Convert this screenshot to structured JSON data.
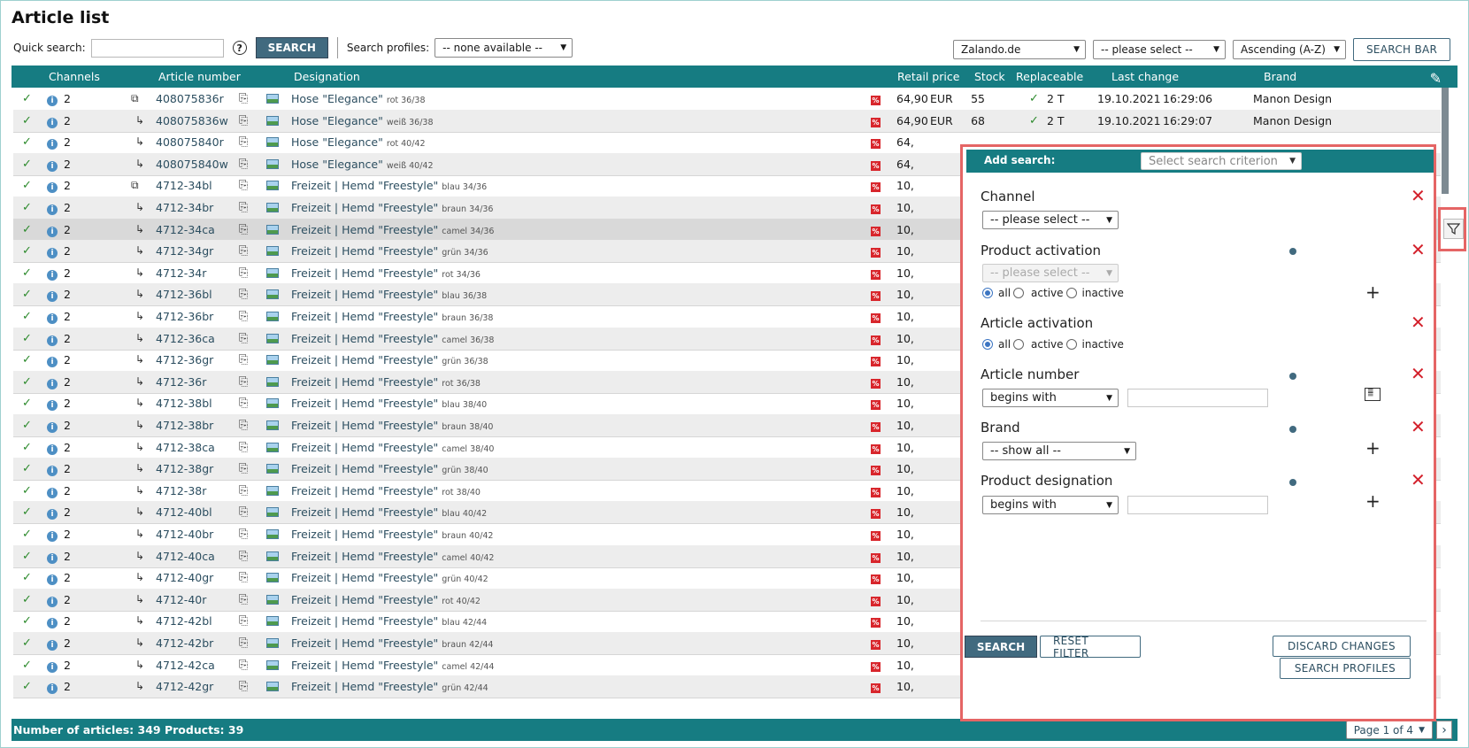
{
  "page": {
    "title": "Article list"
  },
  "toolbar": {
    "quick_search_label": "Quick search:",
    "quick_search_value": "",
    "help_icon": "?",
    "search_label": "SEARCH",
    "profiles_label": "Search profiles:",
    "profiles_value": "-- none available --",
    "shop_value": "Zalando.de",
    "sort_field_value": "-- please select --",
    "sort_order_value": "Ascending (A-Z)",
    "search_bar_label": "SEARCH BAR"
  },
  "table": {
    "headers": {
      "channels": "Channels",
      "article_number": "Article number",
      "designation": "Designation",
      "retail_price": "Retail price",
      "stock": "Stock",
      "replaceable": "Replaceable",
      "last_change": "Last change",
      "brand": "Brand"
    },
    "rows": [
      {
        "channels": "2",
        "variant": "parent",
        "article_number": "408075836r",
        "designation": "Hose \"Elegance\"",
        "variant_text": "rot 36/38",
        "price": "64,90",
        "currency": "EUR",
        "stock": "55",
        "replaceable": "2 T",
        "date": "19.10.2021",
        "time": "16:29:06",
        "brand": "Manon Design"
      },
      {
        "channels": "2",
        "variant": "child",
        "article_number": "408075836w",
        "designation": "Hose \"Elegance\"",
        "variant_text": "weiß 36/38",
        "price": "64,90",
        "currency": "EUR",
        "stock": "68",
        "replaceable": "2 T",
        "date": "19.10.2021",
        "time": "16:29:07",
        "brand": "Manon Design"
      },
      {
        "channels": "2",
        "variant": "child",
        "article_number": "408075840r",
        "designation": "Hose \"Elegance\"",
        "variant_text": "rot 40/42",
        "price": "64,",
        "currency": "",
        "stock": "",
        "replaceable": "",
        "date": "",
        "time": "",
        "brand": ""
      },
      {
        "channels": "2",
        "variant": "child",
        "article_number": "408075840w",
        "designation": "Hose \"Elegance\"",
        "variant_text": "weiß 40/42",
        "price": "64,",
        "currency": "",
        "stock": "",
        "replaceable": "",
        "date": "",
        "time": "",
        "brand": ""
      },
      {
        "channels": "2",
        "variant": "parent",
        "article_number": "4712-34bl",
        "designation": "Freizeit | Hemd \"Freestyle\"",
        "variant_text": "blau 34/36",
        "price": "10,"
      },
      {
        "channels": "2",
        "variant": "child",
        "article_number": "4712-34br",
        "designation": "Freizeit | Hemd \"Freestyle\"",
        "variant_text": "braun 34/36",
        "price": "10,"
      },
      {
        "channels": "2",
        "variant": "child",
        "article_number": "4712-34ca",
        "designation": "Freizeit | Hemd \"Freestyle\"",
        "variant_text": "camel 34/36",
        "price": "10,"
      },
      {
        "channels": "2",
        "variant": "child",
        "article_number": "4712-34gr",
        "designation": "Freizeit | Hemd \"Freestyle\"",
        "variant_text": "grün 34/36",
        "price": "10,"
      },
      {
        "channels": "2",
        "variant": "child",
        "article_number": "4712-34r",
        "designation": "Freizeit | Hemd \"Freestyle\"",
        "variant_text": "rot 34/36",
        "price": "10,"
      },
      {
        "channels": "2",
        "variant": "child",
        "article_number": "4712-36bl",
        "designation": "Freizeit | Hemd \"Freestyle\"",
        "variant_text": "blau 36/38",
        "price": "10,"
      },
      {
        "channels": "2",
        "variant": "child",
        "article_number": "4712-36br",
        "designation": "Freizeit | Hemd \"Freestyle\"",
        "variant_text": "braun 36/38",
        "price": "10,"
      },
      {
        "channels": "2",
        "variant": "child",
        "article_number": "4712-36ca",
        "designation": "Freizeit | Hemd \"Freestyle\"",
        "variant_text": "camel 36/38",
        "price": "10,"
      },
      {
        "channels": "2",
        "variant": "child",
        "article_number": "4712-36gr",
        "designation": "Freizeit | Hemd \"Freestyle\"",
        "variant_text": "grün 36/38",
        "price": "10,"
      },
      {
        "channels": "2",
        "variant": "child",
        "article_number": "4712-36r",
        "designation": "Freizeit | Hemd \"Freestyle\"",
        "variant_text": "rot 36/38",
        "price": "10,"
      },
      {
        "channels": "2",
        "variant": "child",
        "article_number": "4712-38bl",
        "designation": "Freizeit | Hemd \"Freestyle\"",
        "variant_text": "blau 38/40",
        "price": "10,"
      },
      {
        "channels": "2",
        "variant": "child",
        "article_number": "4712-38br",
        "designation": "Freizeit | Hemd \"Freestyle\"",
        "variant_text": "braun 38/40",
        "price": "10,"
      },
      {
        "channels": "2",
        "variant": "child",
        "article_number": "4712-38ca",
        "designation": "Freizeit | Hemd \"Freestyle\"",
        "variant_text": "camel 38/40",
        "price": "10,"
      },
      {
        "channels": "2",
        "variant": "child",
        "article_number": "4712-38gr",
        "designation": "Freizeit | Hemd \"Freestyle\"",
        "variant_text": "grün 38/40",
        "price": "10,"
      },
      {
        "channels": "2",
        "variant": "child",
        "article_number": "4712-38r",
        "designation": "Freizeit | Hemd \"Freestyle\"",
        "variant_text": "rot 38/40",
        "price": "10,"
      },
      {
        "channels": "2",
        "variant": "child",
        "article_number": "4712-40bl",
        "designation": "Freizeit | Hemd \"Freestyle\"",
        "variant_text": "blau 40/42",
        "price": "10,"
      },
      {
        "channels": "2",
        "variant": "child",
        "article_number": "4712-40br",
        "designation": "Freizeit | Hemd \"Freestyle\"",
        "variant_text": "braun 40/42",
        "price": "10,"
      },
      {
        "channels": "2",
        "variant": "child",
        "article_number": "4712-40ca",
        "designation": "Freizeit | Hemd \"Freestyle\"",
        "variant_text": "camel 40/42",
        "price": "10,"
      },
      {
        "channels": "2",
        "variant": "child",
        "article_number": "4712-40gr",
        "designation": "Freizeit | Hemd \"Freestyle\"",
        "variant_text": "grün 40/42",
        "price": "10,"
      },
      {
        "channels": "2",
        "variant": "child",
        "article_number": "4712-40r",
        "designation": "Freizeit | Hemd \"Freestyle\"",
        "variant_text": "rot 40/42",
        "price": "10,"
      },
      {
        "channels": "2",
        "variant": "child",
        "article_number": "4712-42bl",
        "designation": "Freizeit | Hemd \"Freestyle\"",
        "variant_text": "blau 42/44",
        "price": "10,"
      },
      {
        "channels": "2",
        "variant": "child",
        "article_number": "4712-42br",
        "designation": "Freizeit | Hemd \"Freestyle\"",
        "variant_text": "braun 42/44",
        "price": "10,"
      },
      {
        "channels": "2",
        "variant": "child",
        "article_number": "4712-42ca",
        "designation": "Freizeit | Hemd \"Freestyle\"",
        "variant_text": "camel 42/44",
        "price": "10,"
      },
      {
        "channels": "2",
        "variant": "child",
        "article_number": "4712-42gr",
        "designation": "Freizeit | Hemd \"Freestyle\"",
        "variant_text": "grün 42/44",
        "price": "10,"
      }
    ],
    "selected_row": 6
  },
  "status": {
    "count_text": "Number of articles: 349  Products: 39",
    "page_label": "Page 1 of 4",
    "next_icon": "›"
  },
  "search_panel": {
    "add_search_label": "Add search:",
    "criterion_placeholder": "Select search criterion",
    "channel": {
      "title": "Channel",
      "select_value": "-- please select --"
    },
    "product_activation": {
      "title": "Product activation",
      "select_value": "-- please select --",
      "options": [
        "all",
        "active",
        "inactive"
      ],
      "selected": "all"
    },
    "article_activation": {
      "title": "Article activation",
      "options": [
        "all",
        "active",
        "inactive"
      ],
      "selected": "all"
    },
    "article_number": {
      "title": "Article number",
      "select_value": "begins with",
      "input_value": ""
    },
    "brand": {
      "title": "Brand",
      "select_value": "-- show all --"
    },
    "product_designation": {
      "title": "Product designation",
      "select_value": "begins with",
      "input_value": ""
    },
    "buttons": {
      "search": "SEARCH",
      "reset": "RESET FILTER",
      "discard": "DISCARD CHANGES",
      "profiles": "SEARCH PROFILES"
    }
  },
  "colors": {
    "header_teal": "#167c82",
    "button_dark": "#416a7f",
    "delete_red": "#d3202b",
    "highlight_border": "#e56565"
  }
}
